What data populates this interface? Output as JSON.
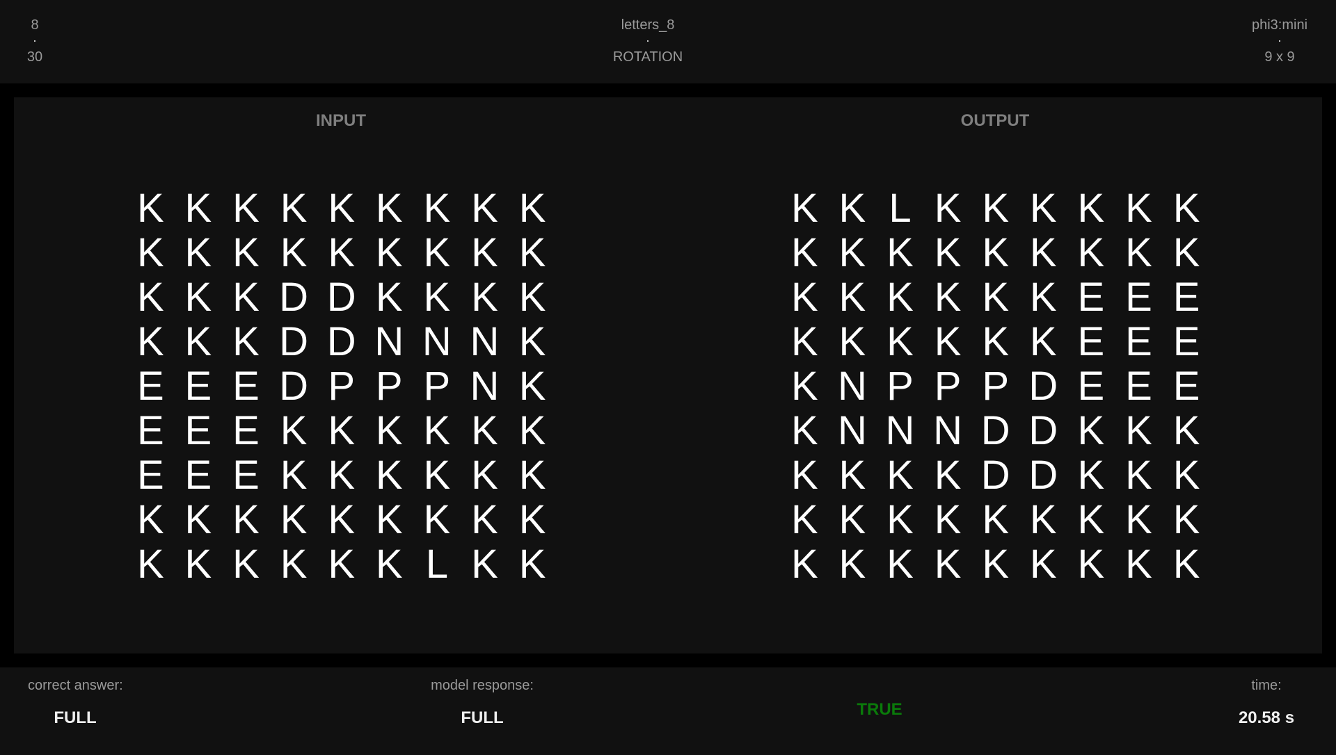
{
  "header": {
    "left": {
      "top": "8",
      "bottom": "30"
    },
    "center": {
      "top": "letters_8",
      "bottom": "ROTATION"
    },
    "right": {
      "top": "phi3:mini",
      "bottom": "9 x 9"
    }
  },
  "panel": {
    "input_title": "INPUT",
    "output_title": "OUTPUT",
    "input_grid": [
      [
        "K",
        "K",
        "K",
        "K",
        "K",
        "K",
        "K",
        "K",
        "K"
      ],
      [
        "K",
        "K",
        "K",
        "K",
        "K",
        "K",
        "K",
        "K",
        "K"
      ],
      [
        "K",
        "K",
        "K",
        "D",
        "D",
        "K",
        "K",
        "K",
        "K"
      ],
      [
        "K",
        "K",
        "K",
        "D",
        "D",
        "N",
        "N",
        "N",
        "K"
      ],
      [
        "E",
        "E",
        "E",
        "D",
        "P",
        "P",
        "P",
        "N",
        "K"
      ],
      [
        "E",
        "E",
        "E",
        "K",
        "K",
        "K",
        "K",
        "K",
        "K"
      ],
      [
        "E",
        "E",
        "E",
        "K",
        "K",
        "K",
        "K",
        "K",
        "K"
      ],
      [
        "K",
        "K",
        "K",
        "K",
        "K",
        "K",
        "K",
        "K",
        "K"
      ],
      [
        "K",
        "K",
        "K",
        "K",
        "K",
        "K",
        "L",
        "K",
        "K"
      ]
    ],
    "output_grid": [
      [
        "K",
        "K",
        "L",
        "K",
        "K",
        "K",
        "K",
        "K",
        "K"
      ],
      [
        "K",
        "K",
        "K",
        "K",
        "K",
        "K",
        "K",
        "K",
        "K"
      ],
      [
        "K",
        "K",
        "K",
        "K",
        "K",
        "K",
        "E",
        "E",
        "E"
      ],
      [
        "K",
        "K",
        "K",
        "K",
        "K",
        "K",
        "E",
        "E",
        "E"
      ],
      [
        "K",
        "N",
        "P",
        "P",
        "P",
        "D",
        "E",
        "E",
        "E"
      ],
      [
        "K",
        "N",
        "N",
        "N",
        "D",
        "D",
        "K",
        "K",
        "K"
      ],
      [
        "K",
        "K",
        "K",
        "K",
        "D",
        "D",
        "K",
        "K",
        "K"
      ],
      [
        "K",
        "K",
        "K",
        "K",
        "K",
        "K",
        "K",
        "K",
        "K"
      ],
      [
        "K",
        "K",
        "K",
        "K",
        "K",
        "K",
        "K",
        "K",
        "K"
      ]
    ]
  },
  "footer": {
    "correct_label": "correct answer:",
    "correct_value": "FULL",
    "model_label": "model response:",
    "model_value": "FULL",
    "verdict": "TRUE",
    "verdict_color": "#0a7a0a",
    "time_label": "time:",
    "time_value": "20.58 s"
  }
}
